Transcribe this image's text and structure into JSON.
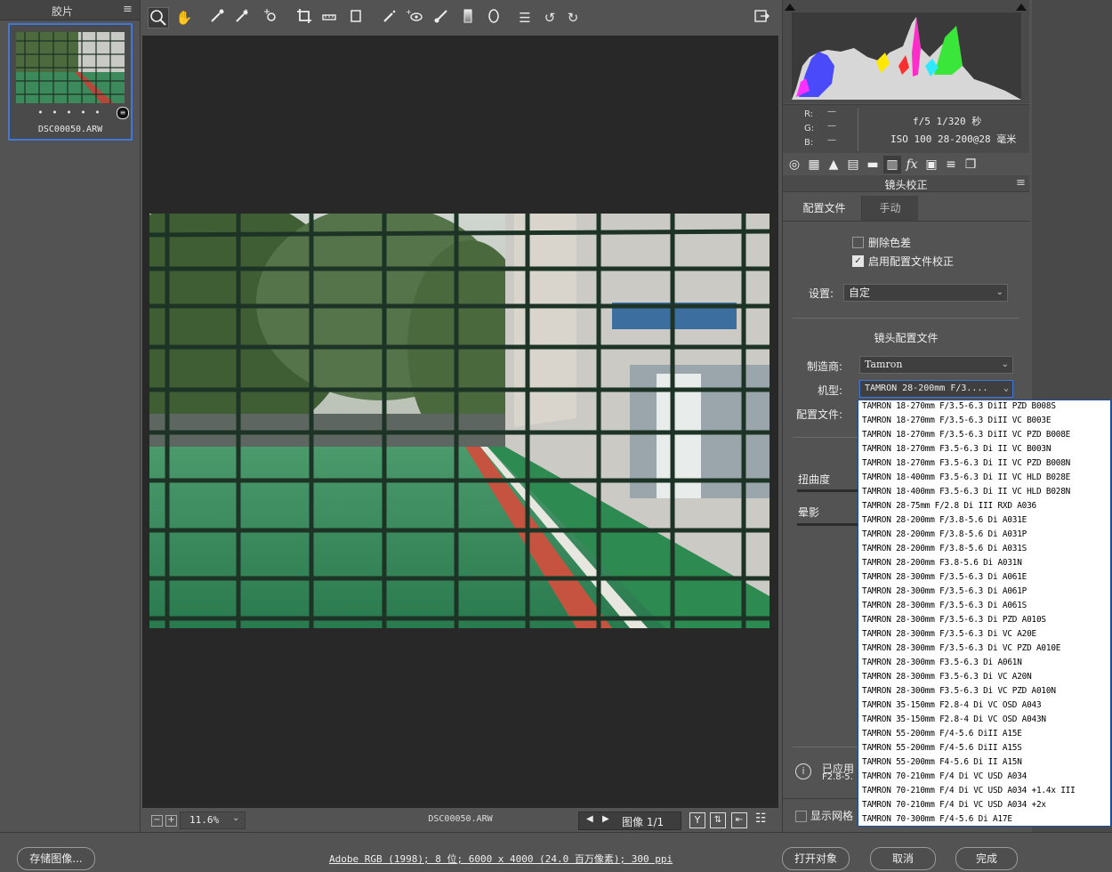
{
  "filmstrip": {
    "title": "胶片",
    "thumbnail_dots": "• • • • •",
    "thumbnail_name": "DSC00050.ARW"
  },
  "toolbar": {
    "tools": [
      "zoom-tool",
      "hand-tool",
      "white-balance-tool",
      "color-sampler-tool",
      "targeted-adjustment-tool",
      "crop-tool",
      "straighten-tool",
      "transform-tool",
      "spot-removal-tool",
      "red-eye-tool",
      "adjustment-brush-tool",
      "graduated-filter-tool",
      "radial-filter-tool",
      "preferences-tool",
      "rotate-left-tool",
      "rotate-right-tool"
    ],
    "fullscreen_icon": "fullscreen-toggle-icon"
  },
  "canvas": {
    "zoom": "11.6%",
    "file_name": "DSC00050.ARW",
    "image_counter": "图像 1/1"
  },
  "histogram": {
    "r_label": "R:",
    "g_label": "G:",
    "b_label": "B:",
    "r_value": "—",
    "g_value": "—",
    "b_value": "—",
    "exif_line1": "f/5  1/320 秒",
    "exif_line2": "ISO 100  28-200@28 毫米"
  },
  "panel": {
    "title": "镜头校正",
    "tabs": [
      "配置文件",
      "手动"
    ],
    "remove_ca_label": "删除色差",
    "enable_profile_label": "启用配置文件校正",
    "setup_label": "设置:",
    "setup_value": "自定",
    "lens_profile_heading": "镜头配置文件",
    "make_label": "制造商:",
    "make_value": "Tamron",
    "model_label": "机型:",
    "model_value": "TAMRON 28-200mm F/3....",
    "profile_label": "配置文件:",
    "distortion_label": "扭曲度",
    "vignetting_label": "晕影",
    "info_text1": "已应用",
    "info_text2": "F2.8-5.",
    "show_grid_label": "显示网格"
  },
  "lens_options": [
    "TAMRON 18-270mm F/3.5-6.3 DiII PZD B008S",
    "TAMRON 18-270mm F/3.5-6.3 DiII VC B003E",
    "TAMRON 18-270mm F/3.5-6.3 DiII VC PZD B008E",
    "TAMRON 18-270mm F3.5-6.3 Di II VC B003N",
    "TAMRON 18-270mm F3.5-6.3 Di II VC PZD B008N",
    "TAMRON 18-400mm F3.5-6.3 Di II VC HLD B028E",
    "TAMRON 18-400mm F3.5-6.3 Di II VC HLD B028N",
    "TAMRON 28-75mm F/2.8 Di III RXD A036",
    "TAMRON 28-200mm F/3.8-5.6 Di A031E",
    "TAMRON 28-200mm F/3.8-5.6 Di A031P",
    "TAMRON 28-200mm F/3.8-5.6 Di A031S",
    "TAMRON 28-200mm F3.8-5.6 Di A031N",
    "TAMRON 28-300mm F/3.5-6.3 Di A061E",
    "TAMRON 28-300mm F/3.5-6.3 Di A061P",
    "TAMRON 28-300mm F/3.5-6.3 Di A061S",
    "TAMRON 28-300mm F/3.5-6.3 Di PZD A010S",
    "TAMRON 28-300mm F/3.5-6.3 Di VC A20E",
    "TAMRON 28-300mm F/3.5-6.3 Di VC PZD A010E",
    "TAMRON 28-300mm F3.5-6.3 Di A061N",
    "TAMRON 28-300mm F3.5-6.3 Di VC A20N",
    "TAMRON 28-300mm F3.5-6.3 Di VC PZD A010N",
    "TAMRON 35-150mm F2.8-4 Di VC OSD A043",
    "TAMRON 35-150mm F2.8-4 Di VC OSD A043N",
    "TAMRON 55-200mm F/4-5.6 DiII A15E",
    "TAMRON 55-200mm F/4-5.6 DiII A15S",
    "TAMRON 55-200mm F4-5.6 Di II A15N",
    "TAMRON 70-210mm F/4 Di VC USD A034",
    "TAMRON 70-210mm F/4 Di VC USD A034 +1.4x III",
    "TAMRON 70-210mm F/4 Di VC USD A034 +2x",
    "TAMRON 70-300mm F/4-5.6 Di A17E"
  ],
  "bottombar": {
    "save_label": "存储图像...",
    "status_link": "Adobe RGB (1998); 8 位; 6000 x 4000 (24.0 百万像素); 300 ppi",
    "open_label": "打开对象",
    "cancel_label": "取消",
    "done_label": "完成"
  },
  "colors": {
    "accent": "#3f78d8",
    "panel_bg": "#535353",
    "canvas_bg": "#282828"
  }
}
